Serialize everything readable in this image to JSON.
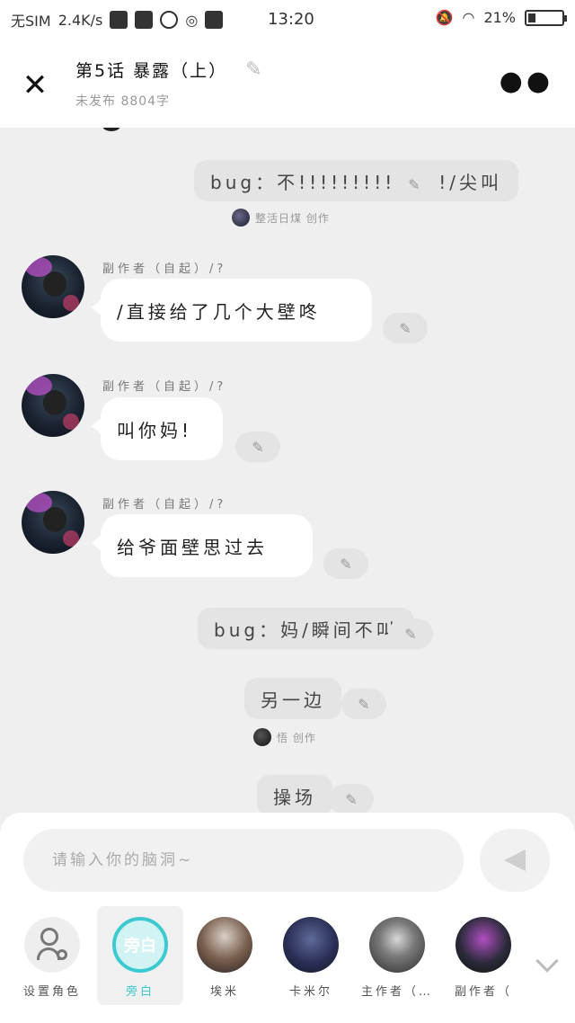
{
  "status_bar": {
    "carrier": "无SIM",
    "speed": "2.4K/s",
    "time": "13:20",
    "battery": "21%"
  },
  "header": {
    "title": "第5话  暴露（上）",
    "subtitle": "未发布 8804字",
    "close_icon": "close-icon",
    "more_icon": "more-icon"
  },
  "messages": [
    {
      "type": "narration",
      "text": "bug：不!!!!!!!!!!!!!!/尖叫",
      "author": "整活日煤 创作"
    },
    {
      "type": "character",
      "speaker": "副作者（自起）/?",
      "text": "/直接给了几个大壁咚"
    },
    {
      "type": "character",
      "speaker": "副作者（自起）/?",
      "text": "叫你妈!"
    },
    {
      "type": "character",
      "speaker": "副作者（自起）/?",
      "text": "给爷面壁思过去"
    },
    {
      "type": "narration",
      "text": "bug：妈/瞬间不叫"
    },
    {
      "type": "narration",
      "text": "另一边",
      "author": "悟 创作"
    },
    {
      "type": "narration",
      "text": "操场"
    }
  ],
  "composer": {
    "placeholder": "请输入你的脑洞~",
    "send_icon": "send-icon"
  },
  "roles": [
    {
      "label": "设置角色",
      "icon": "person-settings-icon"
    },
    {
      "label": "旁白",
      "avatar_text": "旁白",
      "selected": true
    },
    {
      "label": "埃米"
    },
    {
      "label": "卡米尔"
    },
    {
      "label": "主作者（…"
    },
    {
      "label": "副作者（"
    }
  ],
  "colors": {
    "accent": "#3cc9cf",
    "background": "#efefef",
    "bubble": "#ffffff",
    "narration_bubble": "#e4e4e4"
  }
}
